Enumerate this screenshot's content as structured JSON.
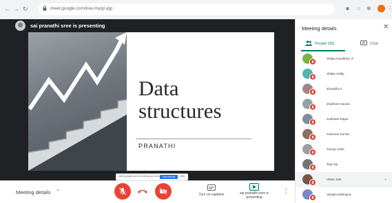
{
  "browser": {
    "url": "meet.google.com/kxe-myqz-jqp",
    "accent_profile": "#e8710a"
  },
  "meeting": {
    "presenter_banner": "sai pranathi sree is presenting",
    "slide": {
      "title_line1": "Data",
      "title_line2": "structures",
      "subtitle": "PRANATHI"
    },
    "share_banner": {
      "text": "meet.google.com is sharing your screen.",
      "stop_label": "Stop sharing",
      "hide_label": "Hide"
    }
  },
  "controls": {
    "meeting_details_label": "Meeting details",
    "captions_label": "Turn on captions",
    "presenting_label": "sai pranathi sree is presenting",
    "icons": [
      "mic-off-icon",
      "hang-up-icon",
      "camera-off-icon",
      "captions-icon",
      "present-icon",
      "more-options-icon"
    ]
  },
  "panel": {
    "title": "Meeting details",
    "tabs": [
      {
        "label": "People (35)",
        "active": true
      },
      {
        "label": "Chat",
        "active": false
      }
    ],
    "participants": [
      {
        "name": "Shilpa Harshitha .P",
        "avatar_color": "#7cb342"
      },
      {
        "name": "Shilpa reddy",
        "avatar_color": "#4db6ac"
      },
      {
        "name": "shraddha k",
        "avatar_color": "#a1887f"
      },
      {
        "name": "shubham saurav",
        "avatar_color": "#90a4ae"
      },
      {
        "name": "Subhash Rajan",
        "avatar_color": "#78909c"
      },
      {
        "name": "Sukumar Kumar",
        "avatar_color": "#8d6e63"
      },
      {
        "name": "Tanuja Joshi",
        "avatar_color": "#9e9e9e"
      },
      {
        "name": "Teja Sai",
        "avatar_color": "#757575"
      },
      {
        "name": "Utsav Jain",
        "avatar_color": "#795548",
        "highlighted": true
      },
      {
        "name": "Vanjala Mahogna",
        "avatar_color": "#7986cb"
      }
    ]
  },
  "colors": {
    "meet_red": "#ea4335",
    "meet_teal": "#00796b",
    "stage_bg": "#202124"
  }
}
